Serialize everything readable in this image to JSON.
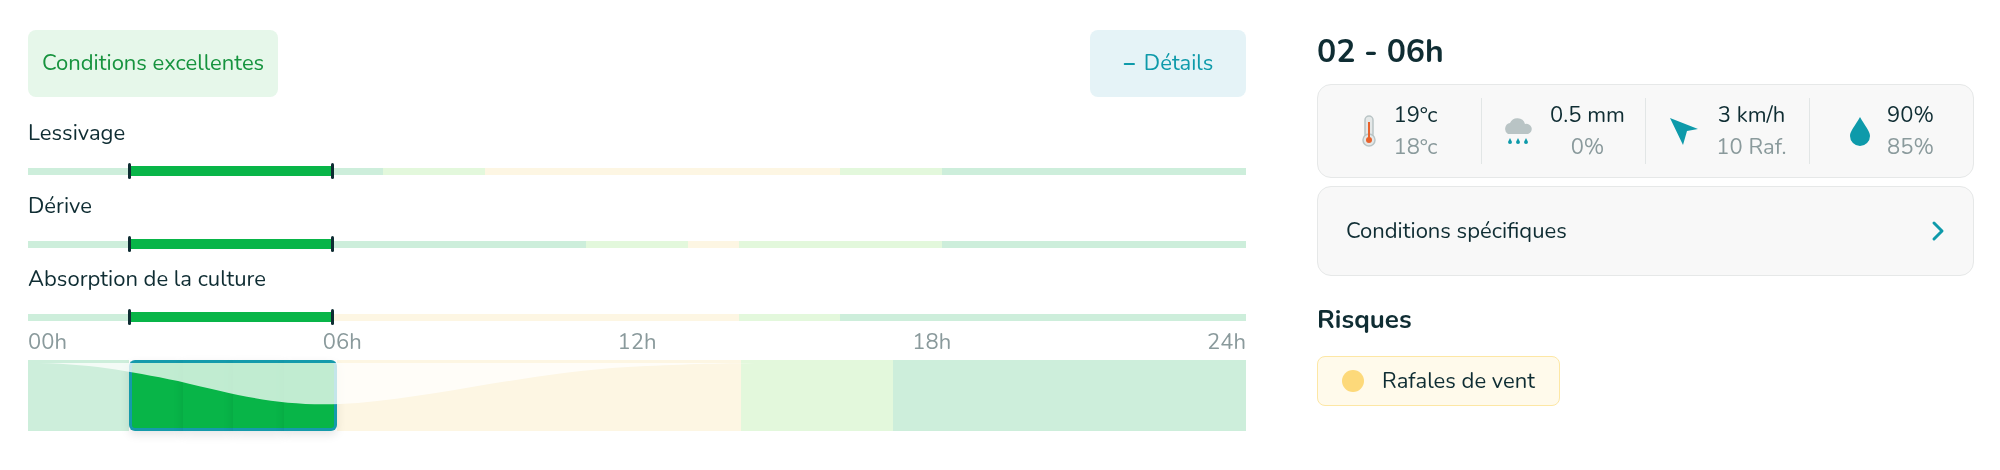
{
  "status_badge": "Conditions excellentes",
  "details_button": {
    "icon": "−",
    "label": "Détails"
  },
  "tracks": [
    {
      "label": "Lessivage",
      "hours": [
        {
          "color": "#cdeedb",
          "selected": false
        },
        {
          "color": "#cdeedb",
          "selected": false
        },
        {
          "color": "#08b548",
          "selected": true
        },
        {
          "color": "#08b548",
          "selected": true
        },
        {
          "color": "#08b548",
          "selected": true
        },
        {
          "color": "#08b548",
          "selected": true
        },
        {
          "color": "#cdeedb",
          "selected": false
        },
        {
          "color": "#e3f8dc",
          "selected": false
        },
        {
          "color": "#e3f8dc",
          "selected": false
        },
        {
          "color": "#fdf6e3",
          "selected": false
        },
        {
          "color": "#fdf6e3",
          "selected": false
        },
        {
          "color": "#fdf6e3",
          "selected": false
        },
        {
          "color": "#fdf6e3",
          "selected": false
        },
        {
          "color": "#fdf6e3",
          "selected": false
        },
        {
          "color": "#fdf6e3",
          "selected": false
        },
        {
          "color": "#fdf6e3",
          "selected": false
        },
        {
          "color": "#e3f8dc",
          "selected": false
        },
        {
          "color": "#e3f8dc",
          "selected": false
        },
        {
          "color": "#cdeedb",
          "selected": false
        },
        {
          "color": "#cdeedb",
          "selected": false
        },
        {
          "color": "#cdeedb",
          "selected": false
        },
        {
          "color": "#cdeedb",
          "selected": false
        },
        {
          "color": "#cdeedb",
          "selected": false
        },
        {
          "color": "#cdeedb",
          "selected": false
        }
      ]
    },
    {
      "label": "Dérive",
      "hours": [
        {
          "color": "#cdeedb",
          "selected": false
        },
        {
          "color": "#cdeedb",
          "selected": false
        },
        {
          "color": "#08b548",
          "selected": true
        },
        {
          "color": "#08b548",
          "selected": true
        },
        {
          "color": "#08b548",
          "selected": true
        },
        {
          "color": "#08b548",
          "selected": true
        },
        {
          "color": "#cdeedb",
          "selected": false
        },
        {
          "color": "#cdeedb",
          "selected": false
        },
        {
          "color": "#cdeedb",
          "selected": false
        },
        {
          "color": "#cdeedb",
          "selected": false
        },
        {
          "color": "#cdeedb",
          "selected": false
        },
        {
          "color": "#e3f8dc",
          "selected": false
        },
        {
          "color": "#e3f8dc",
          "selected": false
        },
        {
          "color": "#fdf6e3",
          "selected": false
        },
        {
          "color": "#e3f8dc",
          "selected": false
        },
        {
          "color": "#e3f8dc",
          "selected": false
        },
        {
          "color": "#e3f8dc",
          "selected": false
        },
        {
          "color": "#e3f8dc",
          "selected": false
        },
        {
          "color": "#cdeedb",
          "selected": false
        },
        {
          "color": "#cdeedb",
          "selected": false
        },
        {
          "color": "#cdeedb",
          "selected": false
        },
        {
          "color": "#cdeedb",
          "selected": false
        },
        {
          "color": "#cdeedb",
          "selected": false
        },
        {
          "color": "#cdeedb",
          "selected": false
        }
      ]
    },
    {
      "label": "Absorption de la culture",
      "hours": [
        {
          "color": "#cdeedb",
          "selected": false
        },
        {
          "color": "#cdeedb",
          "selected": false
        },
        {
          "color": "#08b548",
          "selected": true
        },
        {
          "color": "#08b548",
          "selected": true
        },
        {
          "color": "#08b548",
          "selected": true
        },
        {
          "color": "#08b548",
          "selected": true
        },
        {
          "color": "#fdf6e3",
          "selected": false
        },
        {
          "color": "#fdf6e3",
          "selected": false
        },
        {
          "color": "#fdf6e3",
          "selected": false
        },
        {
          "color": "#fdf6e3",
          "selected": false
        },
        {
          "color": "#fdf6e3",
          "selected": false
        },
        {
          "color": "#fdf6e3",
          "selected": false
        },
        {
          "color": "#fdf6e3",
          "selected": false
        },
        {
          "color": "#fdf6e3",
          "selected": false
        },
        {
          "color": "#e3f8dc",
          "selected": false
        },
        {
          "color": "#e3f8dc",
          "selected": false
        },
        {
          "color": "#cdeedb",
          "selected": false
        },
        {
          "color": "#cdeedb",
          "selected": false
        },
        {
          "color": "#cdeedb",
          "selected": false
        },
        {
          "color": "#cdeedb",
          "selected": false
        },
        {
          "color": "#cdeedb",
          "selected": false
        },
        {
          "color": "#cdeedb",
          "selected": false
        },
        {
          "color": "#cdeedb",
          "selected": false
        },
        {
          "color": "#cdeedb",
          "selected": false
        }
      ]
    }
  ],
  "timeline": {
    "ticks": [
      "00h",
      "06h",
      "12h",
      "18h",
      "24h"
    ],
    "hours": [
      {
        "color": "#cdeedb",
        "selected": false
      },
      {
        "color": "#cdeedb",
        "selected": false
      },
      {
        "color": "#08b548",
        "selected": true
      },
      {
        "color": "#08b548",
        "selected": true
      },
      {
        "color": "#08b548",
        "selected": true
      },
      {
        "color": "#08b548",
        "selected": true
      },
      {
        "color": "#fdf6e3",
        "selected": false
      },
      {
        "color": "#fdf6e3",
        "selected": false
      },
      {
        "color": "#fdf6e3",
        "selected": false
      },
      {
        "color": "#fdf6e3",
        "selected": false
      },
      {
        "color": "#fdf6e3",
        "selected": false
      },
      {
        "color": "#fdf6e3",
        "selected": false
      },
      {
        "color": "#fdf6e3",
        "selected": false
      },
      {
        "color": "#fdf6e3",
        "selected": false
      },
      {
        "color": "#e3f8dc",
        "selected": false
      },
      {
        "color": "#e3f8dc",
        "selected": false
      },
      {
        "color": "#e3f8dc",
        "selected": false
      },
      {
        "color": "#cdeedb",
        "selected": false
      },
      {
        "color": "#cdeedb",
        "selected": false
      },
      {
        "color": "#cdeedb",
        "selected": false
      },
      {
        "color": "#cdeedb",
        "selected": false
      },
      {
        "color": "#cdeedb",
        "selected": false
      },
      {
        "color": "#cdeedb",
        "selected": false
      },
      {
        "color": "#cdeedb",
        "selected": false
      }
    ]
  },
  "period_title": "02 - 06h",
  "weather": [
    {
      "kind": "temperature",
      "value": "19°c",
      "secondary": "18°c"
    },
    {
      "kind": "rain",
      "value": "0.5 mm",
      "secondary": "0%"
    },
    {
      "kind": "wind",
      "value": "3 km/h",
      "secondary": "10 Raf."
    },
    {
      "kind": "humidity",
      "value": "90%",
      "secondary": "85%"
    }
  ],
  "specific_conditions": {
    "label": "Conditions spécifiques"
  },
  "risks_title": "Risques",
  "risks": [
    {
      "label": "Rafales de vent",
      "color": "#fdd97a"
    }
  ]
}
